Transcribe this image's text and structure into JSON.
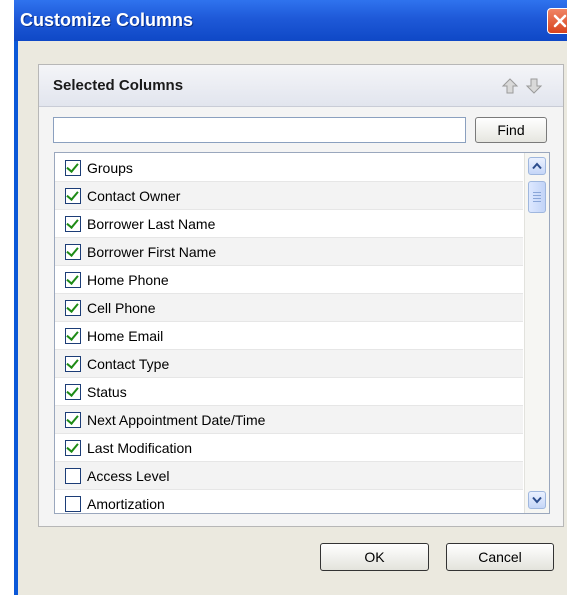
{
  "dialog": {
    "title": "Customize Columns"
  },
  "panel": {
    "title": "Selected Columns"
  },
  "search": {
    "value": "",
    "find_label": "Find"
  },
  "columns": [
    {
      "label": "Groups",
      "checked": true
    },
    {
      "label": "Contact Owner",
      "checked": true
    },
    {
      "label": "Borrower Last Name",
      "checked": true
    },
    {
      "label": "Borrower First Name",
      "checked": true
    },
    {
      "label": "Home Phone",
      "checked": true
    },
    {
      "label": "Cell Phone",
      "checked": true
    },
    {
      "label": "Home Email",
      "checked": true
    },
    {
      "label": "Contact Type",
      "checked": true
    },
    {
      "label": "Status",
      "checked": true
    },
    {
      "label": "Next Appointment Date/Time",
      "checked": true
    },
    {
      "label": "Last Modification",
      "checked": true
    },
    {
      "label": "Access Level",
      "checked": false
    },
    {
      "label": "Amortization",
      "checked": false
    }
  ],
  "buttons": {
    "ok": "OK",
    "cancel": "Cancel"
  },
  "colors": {
    "titlebar": "#1e59d8",
    "window_bg": "#ebe9df",
    "close": "#d8431d",
    "checkmark": "#1e8b16"
  }
}
